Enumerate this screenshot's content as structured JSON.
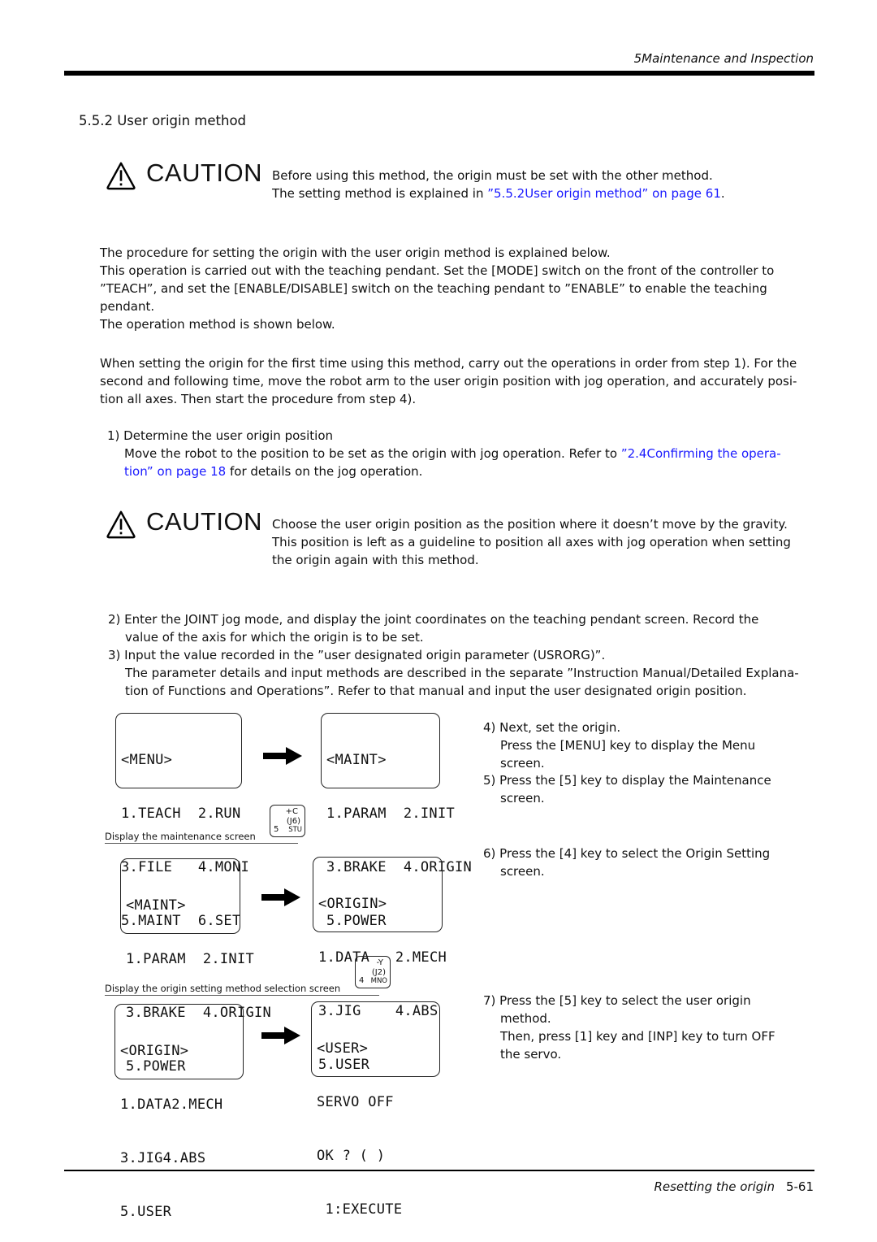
{
  "header": {
    "section": "5Maintenance and Inspection"
  },
  "section_title": "5.5.2 User origin method",
  "caution_word": "CAUTION",
  "caution1": {
    "line1": "Before using this method, the origin must be set with the other method.",
    "line2_prefix": "The setting method is explained in ",
    "line2_link": "”5.5.2User origin method” on page 61",
    "line2_suffix": "."
  },
  "intro": [
    "The procedure for setting the origin with the user origin method is explained below.",
    "This operation is carried out with the teaching pendant. Set the [MODE] switch on the front of the controller to ”TEACH”, and set the [ENABLE/DISABLE] switch on the teaching pendant to ”ENABLE” to enable the teaching pendant.",
    "The operation method is shown below."
  ],
  "first_time": "When setting the origin for the first time using this method, carry out the operations in order from step 1). For the second and following time, move the robot arm to the user origin position with jog operation, and accurately posi-tion all axes. Then start the procedure from step 4).",
  "step1": {
    "title": "1) Determine the user origin position",
    "body_prefix": "Move the robot to the position to be set as the origin with jog operation. Refer to ",
    "body_link": "”2.4Confirming the opera-tion” on page 18",
    "body_suffix": "  for details on the jog operation."
  },
  "caution2": {
    "line1": "Choose the user origin position as the position where it doesn’t move by the gravity.",
    "line2": "This position is left as a guideline to position all axes with jog operation when setting",
    "line3": "the origin again with this method."
  },
  "step2": {
    "line1": "2)  Enter the JOINT jog mode, and display the joint coordinates on the teaching pendant screen. Record the",
    "line2": "value of the axis for which the origin is to be set."
  },
  "step3": {
    "line1": "3)  Input the value recorded in the ”user designated origin parameter (USRORG)”.",
    "line2": "The parameter details and input methods are described in the separate ”Instruction Manual/Detailed Explana-",
    "line3": "tion of Functions and Operations”. Refer to that manual and input the user designated origin position."
  },
  "screens": {
    "menu": [
      "<MENU>",
      "1.TEACH  2.RUN",
      "3.FILE   4.MONI",
      "5.MAINT  6.SET"
    ],
    "maint": [
      "<MAINT>",
      "1.PARAM  2.INIT",
      "3.BRAKE  4.ORIGIN",
      "5.POWER"
    ],
    "maint2": [
      "<MAINT>",
      "1.PARAM  2.INIT",
      "3.BRAKE  4.ORIGIN",
      "5.POWER"
    ],
    "origin": [
      "<ORIGIN>",
      "1.DATA   2.MECH",
      "3.JIG    4.ABS",
      "5.USER"
    ],
    "origin2": [
      "<ORIGIN>",
      "1.DATA2.MECH",
      "3.JIG4.ABS",
      "5.USER"
    ],
    "user": [
      "<USER>",
      "SERVO OFF",
      "OK ? ( )",
      " 1:EXECUTE"
    ]
  },
  "key_notes": {
    "maint": "Display the maintenance screen",
    "origin": "Display the origin setting method selection screen"
  },
  "keys": {
    "key5": {
      "top": "+C",
      "mid": "(J6)",
      "num": "5",
      "letters": "STU"
    },
    "key4": {
      "top": "-Y",
      "mid": "(J2)",
      "num": "4",
      "letters": "MNO"
    }
  },
  "steps_right": {
    "s4_line1": "4) Next, set the origin.",
    "s4_line2": "Press the [MENU] key to display the Menu",
    "s4_line3": "screen.",
    "s5_line1": "5) Press the [5] key to display the Maintenance",
    "s5_line2": "screen.",
    "s6_line1": "6) Press the [4] key to select the Origin Setting",
    "s6_line2": "screen.",
    "s7_line1": "7) Press the [5] key to select the user origin",
    "s7_line2": "method.",
    "s7_line3": "Then, press [1] key and [INP] key to turn OFF",
    "s7_line4": "the servo."
  },
  "footer": {
    "section": "Resetting the origin",
    "page": "5-61"
  }
}
